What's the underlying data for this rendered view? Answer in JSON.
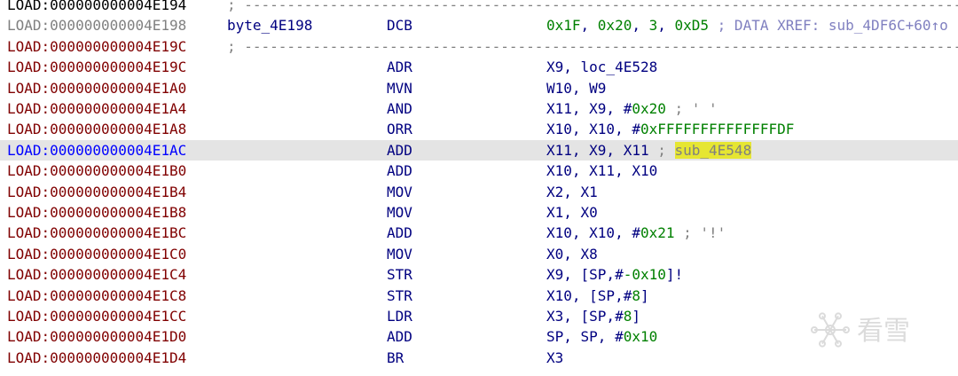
{
  "lines": [
    {
      "addr": "LOAD:000000000004E194",
      "kind": "separator",
      "text": "; -----------------------------------------------------------------------------------------------------------"
    },
    {
      "addr": "LOAD:000000000004E198",
      "kind": "data",
      "label": "byte_4E198",
      "mnemonic": "DCB",
      "operands": [
        {
          "t": "0x1F",
          "c": "num"
        },
        {
          "t": ", ",
          "c": "text"
        },
        {
          "t": "0x20",
          "c": "num"
        },
        {
          "t": ", ",
          "c": "text"
        },
        {
          "t": "3",
          "c": "num"
        },
        {
          "t": ", ",
          "c": "text"
        },
        {
          "t": "0xD5",
          "c": "num"
        },
        {
          "t": " ; DATA XREF: sub_4DF6C+60↑o",
          "c": "xref"
        }
      ]
    },
    {
      "addr": "LOAD:000000000004E19C",
      "kind": "separator",
      "text": "; -----------------------------------------------------------------------------------------------------------"
    },
    {
      "addr": "LOAD:000000000004E19C",
      "kind": "code",
      "mnemonic": "ADR",
      "operands": [
        {
          "t": "X9, loc_4E528",
          "c": "text"
        }
      ]
    },
    {
      "addr": "LOAD:000000000004E1A0",
      "kind": "code",
      "mnemonic": "MVN",
      "operands": [
        {
          "t": "W10, W9",
          "c": "text"
        }
      ]
    },
    {
      "addr": "LOAD:000000000004E1A4",
      "kind": "code",
      "mnemonic": "AND",
      "operands": [
        {
          "t": "X11, X9, #",
          "c": "text"
        },
        {
          "t": "0x20",
          "c": "num"
        },
        {
          "t": " ; ' '",
          "c": "cmt"
        }
      ]
    },
    {
      "addr": "LOAD:000000000004E1A8",
      "kind": "code",
      "mnemonic": "ORR",
      "operands": [
        {
          "t": "X10, X10, #",
          "c": "text"
        },
        {
          "t": "0xFFFFFFFFFFFFFFDF",
          "c": "num"
        }
      ]
    },
    {
      "addr": "LOAD:000000000004E1AC",
      "kind": "code",
      "selected": true,
      "mnemonic": "ADD",
      "operands": [
        {
          "t": "X11, X9, X11",
          "c": "text"
        },
        {
          "t": " ; ",
          "c": "cmt"
        },
        {
          "t": "sub_4E548",
          "c": "hl"
        }
      ]
    },
    {
      "addr": "LOAD:000000000004E1B0",
      "kind": "code",
      "mnemonic": "ADD",
      "operands": [
        {
          "t": "X10, X11, X10",
          "c": "text"
        }
      ]
    },
    {
      "addr": "LOAD:000000000004E1B4",
      "kind": "code",
      "mnemonic": "MOV",
      "operands": [
        {
          "t": "X2, X1",
          "c": "text"
        }
      ]
    },
    {
      "addr": "LOAD:000000000004E1B8",
      "kind": "code",
      "mnemonic": "MOV",
      "operands": [
        {
          "t": "X1, X0",
          "c": "text"
        }
      ]
    },
    {
      "addr": "LOAD:000000000004E1BC",
      "kind": "code",
      "mnemonic": "ADD",
      "operands": [
        {
          "t": "X10, X10, #",
          "c": "text"
        },
        {
          "t": "0x21",
          "c": "num"
        },
        {
          "t": " ; '!'",
          "c": "cmt"
        }
      ]
    },
    {
      "addr": "LOAD:000000000004E1C0",
      "kind": "code",
      "mnemonic": "MOV",
      "operands": [
        {
          "t": "X0, X8",
          "c": "text"
        }
      ]
    },
    {
      "addr": "LOAD:000000000004E1C4",
      "kind": "code",
      "mnemonic": "STR",
      "operands": [
        {
          "t": "X9, [SP,#",
          "c": "text"
        },
        {
          "t": "-0x10",
          "c": "num"
        },
        {
          "t": "]!",
          "c": "text"
        }
      ]
    },
    {
      "addr": "LOAD:000000000004E1C8",
      "kind": "code",
      "mnemonic": "STR",
      "operands": [
        {
          "t": "X10, [SP,#",
          "c": "text"
        },
        {
          "t": "8",
          "c": "num"
        },
        {
          "t": "]",
          "c": "text"
        }
      ]
    },
    {
      "addr": "LOAD:000000000004E1CC",
      "kind": "code",
      "mnemonic": "LDR",
      "operands": [
        {
          "t": "X3, [SP,#",
          "c": "text"
        },
        {
          "t": "8",
          "c": "num"
        },
        {
          "t": "]",
          "c": "text"
        }
      ]
    },
    {
      "addr": "LOAD:000000000004E1D0",
      "kind": "code",
      "mnemonic": "ADD",
      "operands": [
        {
          "t": "SP, SP, #",
          "c": "text"
        },
        {
          "t": "0x10",
          "c": "num"
        }
      ]
    },
    {
      "addr": "LOAD:000000000004E1D4",
      "kind": "code",
      "mnemonic": "BR",
      "operands": [
        {
          "t": "X3",
          "c": "text"
        }
      ]
    }
  ],
  "watermark": {
    "text": "看雪",
    "icon": "snowflake-icon"
  }
}
